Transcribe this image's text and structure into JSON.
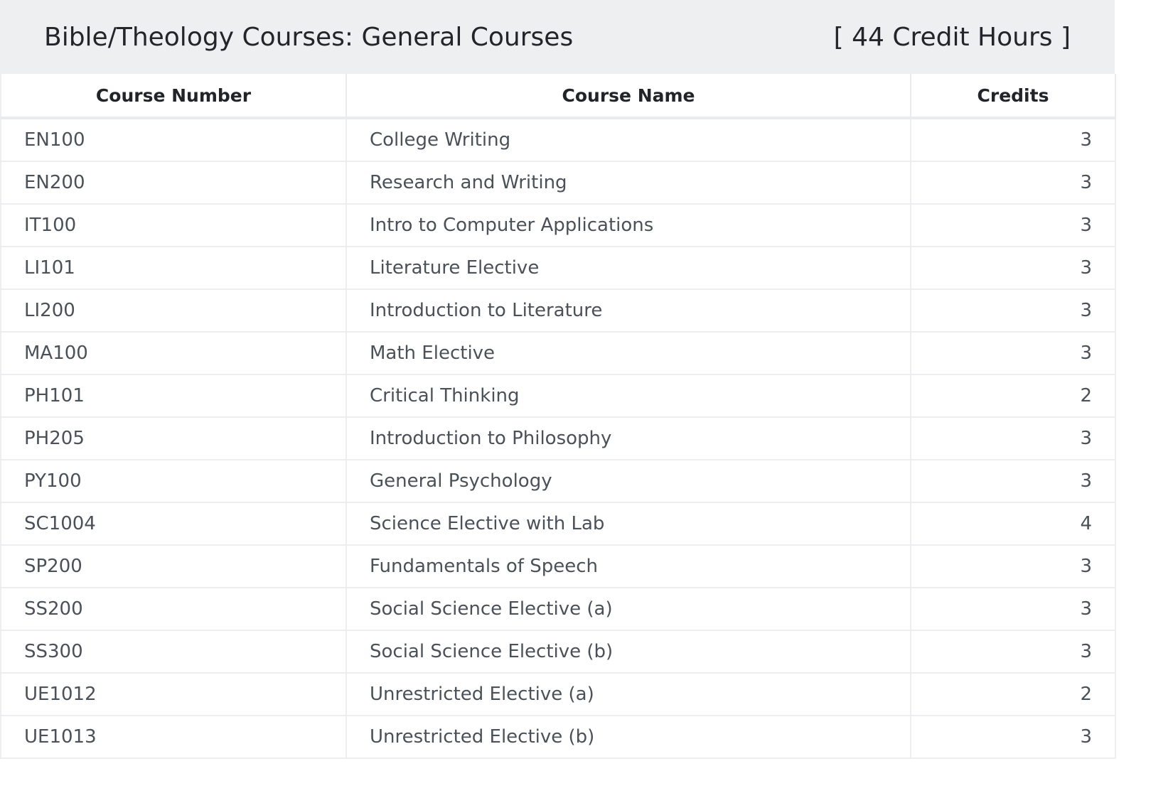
{
  "header": {
    "title": "Bible/Theology Courses: General Courses",
    "credit_hours": "[ 44 Credit Hours ]"
  },
  "table": {
    "columns": [
      "Course Number",
      "Course Name",
      "Credits"
    ],
    "rows": [
      {
        "number": "EN100",
        "name": "College Writing",
        "credits": "3"
      },
      {
        "number": "EN200",
        "name": "Research and Writing",
        "credits": "3"
      },
      {
        "number": "IT100",
        "name": "Intro to Computer Applications",
        "credits": "3"
      },
      {
        "number": "LI101",
        "name": "Literature Elective",
        "credits": "3"
      },
      {
        "number": "LI200",
        "name": "Introduction to Literature",
        "credits": "3"
      },
      {
        "number": "MA100",
        "name": "Math Elective",
        "credits": "3"
      },
      {
        "number": "PH101",
        "name": "Critical Thinking",
        "credits": "2"
      },
      {
        "number": "PH205",
        "name": "Introduction to Philosophy",
        "credits": "3"
      },
      {
        "number": "PY100",
        "name": "General Psychology",
        "credits": "3"
      },
      {
        "number": "SC1004",
        "name": "Science Elective with Lab",
        "credits": "4"
      },
      {
        "number": "SP200",
        "name": "Fundamentals of Speech",
        "credits": "3"
      },
      {
        "number": "SS200",
        "name": "Social Science Elective (a)",
        "credits": "3"
      },
      {
        "number": "SS300",
        "name": "Social Science Elective (b)",
        "credits": "3"
      },
      {
        "number": "UE1012",
        "name": "Unrestricted Elective (a)",
        "credits": "2"
      },
      {
        "number": "UE1013",
        "name": "Unrestricted Elective (b)",
        "credits": "3"
      }
    ]
  },
  "colors": {
    "header_background": "#eeeff1",
    "border": "#eceef1",
    "header_text": "#222529",
    "cell_text": "#4a5158"
  }
}
